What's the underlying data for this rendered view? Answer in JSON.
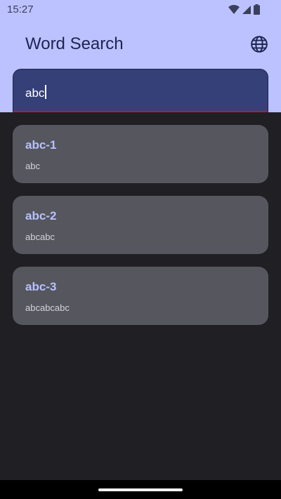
{
  "status_bar": {
    "time": "15:27"
  },
  "app_bar": {
    "title": "Word Search",
    "language_icon": "globe-icon"
  },
  "search": {
    "value": "abc"
  },
  "results": [
    {
      "title": "abc-1",
      "subtitle": "abc"
    },
    {
      "title": "abc-2",
      "subtitle": "abcabc"
    },
    {
      "title": "abc-3",
      "subtitle": "abcabcabc"
    }
  ],
  "colors": {
    "header_bg": "#bcc2ff",
    "search_bg": "#354078",
    "search_underline": "#c0172b",
    "card_bg": "#56565e",
    "card_title": "#b8c1ff",
    "page_bg": "#1f1f24"
  }
}
